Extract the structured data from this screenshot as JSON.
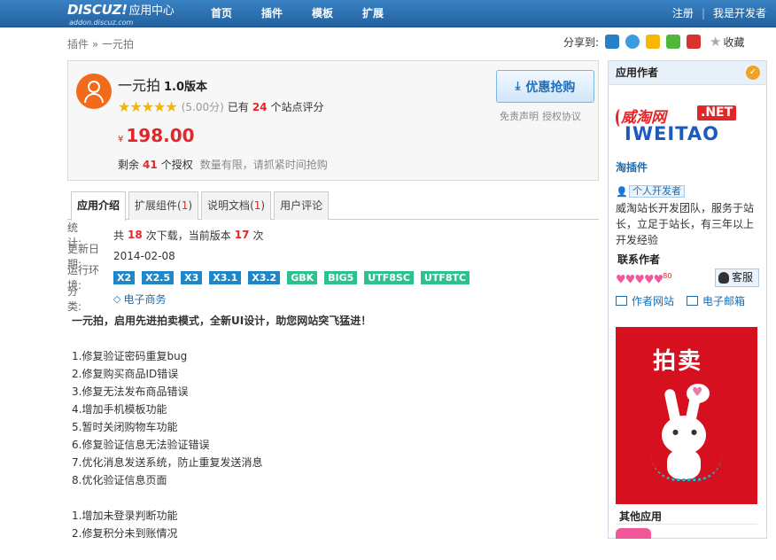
{
  "header": {
    "logo_main": "DISCUZ!",
    "logo_cn": "应用中心",
    "logo_sub": "addon.discuz.com",
    "nav": [
      "首页",
      "插件",
      "模板",
      "扩展"
    ],
    "register": "注册",
    "separator": "|",
    "developer": "我是开发者"
  },
  "breadcrumb": {
    "root": "插件",
    "sep": "»",
    "current": "一元拍"
  },
  "share": {
    "label": "分享到:",
    "fav": "收藏"
  },
  "product": {
    "name": "一元拍",
    "version": "1.0版本",
    "stars": "★★★★★",
    "score": "(5.00分)",
    "rated_pre": "已有",
    "rated_count": "24",
    "rated_post": "个站点评分",
    "currency": "¥",
    "price": "198.00",
    "stock_pre": "剩余",
    "stock_count": "41",
    "stock_post": "个授权",
    "stock_hint": "数量有限，请抓紧时间抢购",
    "buy_label": "优惠抢购",
    "disclaimer": "免责声明",
    "license": "授权协议"
  },
  "tabs": [
    {
      "label": "应用介绍",
      "count": ""
    },
    {
      "label": "扩展组件",
      "count": "1"
    },
    {
      "label": "说明文档",
      "count": "1"
    },
    {
      "label": "用户评论",
      "count": ""
    }
  ],
  "info": {
    "stats_label": "统　　计:",
    "stats_pre": "共",
    "downloads": "18",
    "stats_mid": "次下载，当前版本",
    "version_downloads": "17",
    "stats_post": "次",
    "updated_label": "更新日期:",
    "updated": "2014-02-08",
    "env_label": "运行环境:",
    "env_blue": [
      "X2",
      "X2.5",
      "X3",
      "X3.1",
      "X3.2"
    ],
    "env_green": [
      "GBK",
      "BIG5",
      "UTF8SC",
      "UTF8TC"
    ],
    "category_label": "分　　类:",
    "category": "电子商务"
  },
  "description": {
    "lead": "一元拍，启用先进拍卖模式，全新UI设计，助您网站突飞猛进！",
    "group1": [
      "1.修复验证密码重复bug",
      "2.修复购买商品ID错误",
      "3.修复无法发布商品错误",
      "4.增加手机模板功能",
      "5.暂时关闭购物车功能",
      "6.修复验证信息无法验证错误",
      "7.优化消息发送系统，防止重复发送消息",
      "8.优化验证信息页面"
    ],
    "group2": [
      "1.增加未登录判断功能",
      "2.修复积分未到账情况"
    ]
  },
  "sidebar": {
    "title": "应用作者",
    "logo_cn": "威淘网",
    "logo_net": ".NET",
    "logo_en": "IWEITAO",
    "shop": "淘插件",
    "dev_tag": "个人开发者",
    "intro": "威淘站长开发团队，服务于站长，立足于站长，有三年以上开发经验",
    "contact_title": "联系作者",
    "hearts": "♥♥♥♥♥",
    "heart_level": "80",
    "service": "客服",
    "site_link": "作者网站",
    "mail_link": "电子邮箱",
    "ad_title": "拍卖",
    "others_title": "其他应用"
  },
  "colors": {
    "header_bg": "#2b6cb0",
    "accent_red": "#e2262a",
    "link_blue": "#1a6eb5",
    "badge_blue": "#1f86c8",
    "badge_green": "#2dc28d"
  }
}
